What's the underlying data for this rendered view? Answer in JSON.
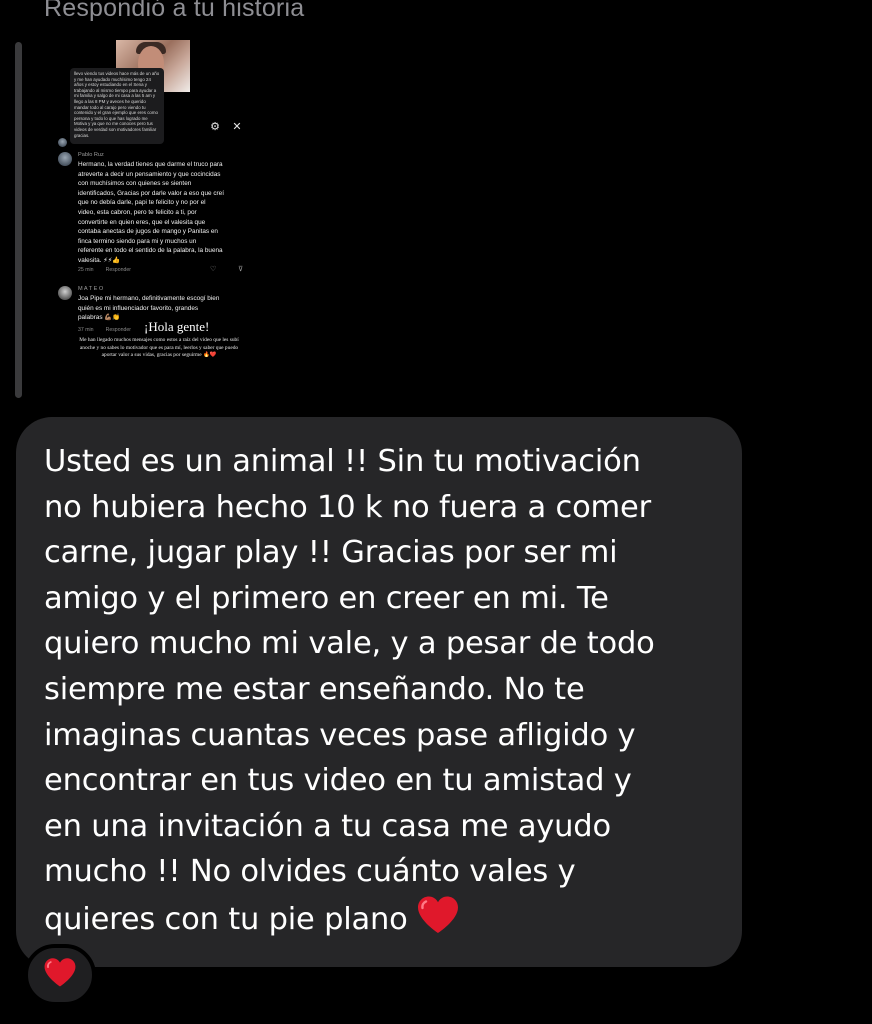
{
  "header": {
    "reply_label": "Respondió a tu historia"
  },
  "story": {
    "tooltip_text": "llevo viendo tus videos hace más de un año y me han ayudado muchísimo tengo 24 años y estoy estudiando en el Sena y trabajando al mismo tiempo para ayudar a mi familia y salgo de mi casa a las 5 am y llego a las 8 PM y aveces he querido mandar todo al carajo pero viendo tu contenido y el gran ejemplo que eres como persona y todo lo que has logrado me Motiva y ya que no me conoces pero tus videos de verdad son motivadores familiar gracias.",
    "comment1": {
      "user": "Pablo Ruz",
      "lines": [
        "Hermano, la verdad tienes que darme el truco para",
        "atreverte a decir un pensamiento y que cocincidas",
        "con muchísimos con quienes se sienten",
        "identificados, Gracias por darle valor a eso que creí",
        "que no debía darle, papi te felicito y no por el",
        "video, esta cabron, pero te felicito a ti, por",
        "convertirte en quien eres, que el valesita que",
        "contaba anectas de jugos de mango y Panitas en",
        "finca termino siendo para mi y muchos un",
        "referente en todo el sentido de la palabra, la buena",
        "valesita. ⚡⚡👍"
      ],
      "time": "25 min",
      "reply": "Responder"
    },
    "comment2": {
      "user": "M A T E O",
      "lines": [
        "Joa Pipe mi hermano, definitivamente escogí bien",
        "quién es mi influenciador favorito, grandes",
        "palabras 💪🏽👏"
      ],
      "time": "37 min",
      "reply": "Responder"
    },
    "hola_title": "¡Hola gente!",
    "hola_body": "Me han llegado muchos mensajes como estos a raíz del video que les subí anoche y no sabes lo motivador que es para mí, leerlos y saber que puedo aportar valor a sus vidas, gracias por seguirme 🔥❤️"
  },
  "message": {
    "text": "Usted es un animal !! Sin tu motivación\nno hubiera hecho 10 k no fuera a comer\ncarne, jugar play !! Gracias por ser mi\namigo y el primero en creer en mi. Te\nquiero mucho mi vale, y a pesar de todo\nsiempre me estar enseñando. No te\nimaginas cuantas veces pase afligido y\nencontrar en tus video en tu amistad y\nen una invitación a tu casa me ayudo\nmucho !! No olvides cuánto vales y\nquieres con tu pie plano",
    "trailing_emoji": "red-heart-icon"
  },
  "reaction": {
    "emoji": "red-heart-icon"
  },
  "colors": {
    "background": "#000000",
    "bubble": "#262628",
    "muted_text": "#8e8e93",
    "heart": "#e0182b"
  }
}
